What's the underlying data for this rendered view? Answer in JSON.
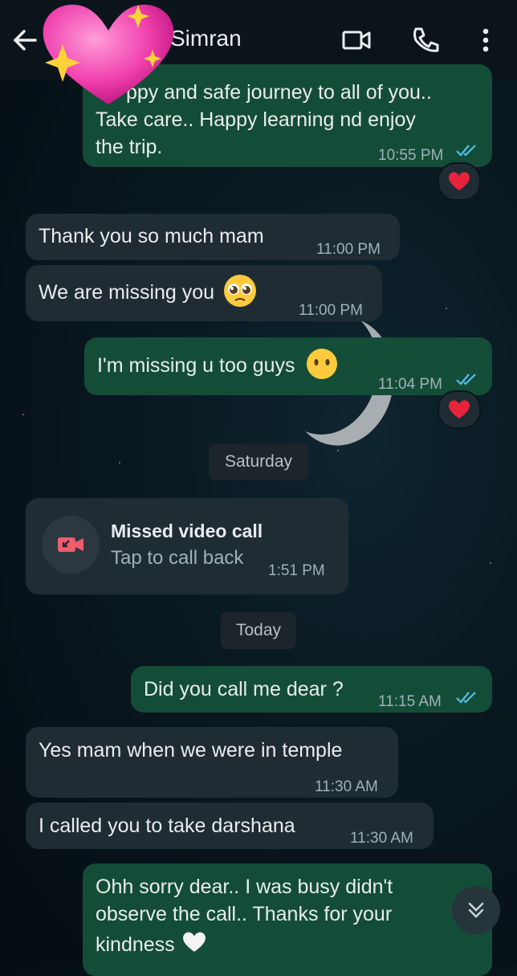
{
  "header": {
    "contact_name": "Simran"
  },
  "messages": [
    {
      "type": "out",
      "text": "Happy and safe journey to all of you.. Take care.. Happy learning nd enjoy the trip.",
      "line1": "ppy and safe journey to all of you..",
      "line2": "Take care.. Happy learning nd enjoy",
      "line3": "the trip.",
      "time": "10:55 PM",
      "reaction": "heart"
    },
    {
      "type": "in",
      "text": "Thank you so much mam",
      "time": "11:00 PM"
    },
    {
      "type": "in",
      "text": "We are missing you",
      "time": "11:00 PM",
      "emoji": "pleading-face"
    },
    {
      "type": "out",
      "text": "I'm missing u too guys",
      "time": "11:04 PM",
      "emoji": "no-mouth-face",
      "reaction": "heart"
    },
    {
      "type": "date",
      "text": "Saturday"
    },
    {
      "type": "missed_call",
      "title": "Missed video call",
      "subtitle": "Tap to call back",
      "time": "1:51 PM"
    },
    {
      "type": "date",
      "text": "Today"
    },
    {
      "type": "out",
      "text": "Did you call me dear ?",
      "time": "11:15 AM"
    },
    {
      "type": "in",
      "text": "Yes mam when we were in temple",
      "time": "11:30 AM"
    },
    {
      "type": "in",
      "text": "I called you to take darshana",
      "time": "11:30 AM"
    },
    {
      "type": "out",
      "line1": "Ohh sorry dear.. I was busy didn't",
      "line2": "observe the call.. Thanks for your",
      "line3": "kindness",
      "emoji": "white-heart"
    }
  ],
  "colors": {
    "outgoing": "#144d37",
    "incoming": "#1f2c33",
    "read_ticks": "#53bdeb",
    "missed_call": "#f15c6d"
  }
}
